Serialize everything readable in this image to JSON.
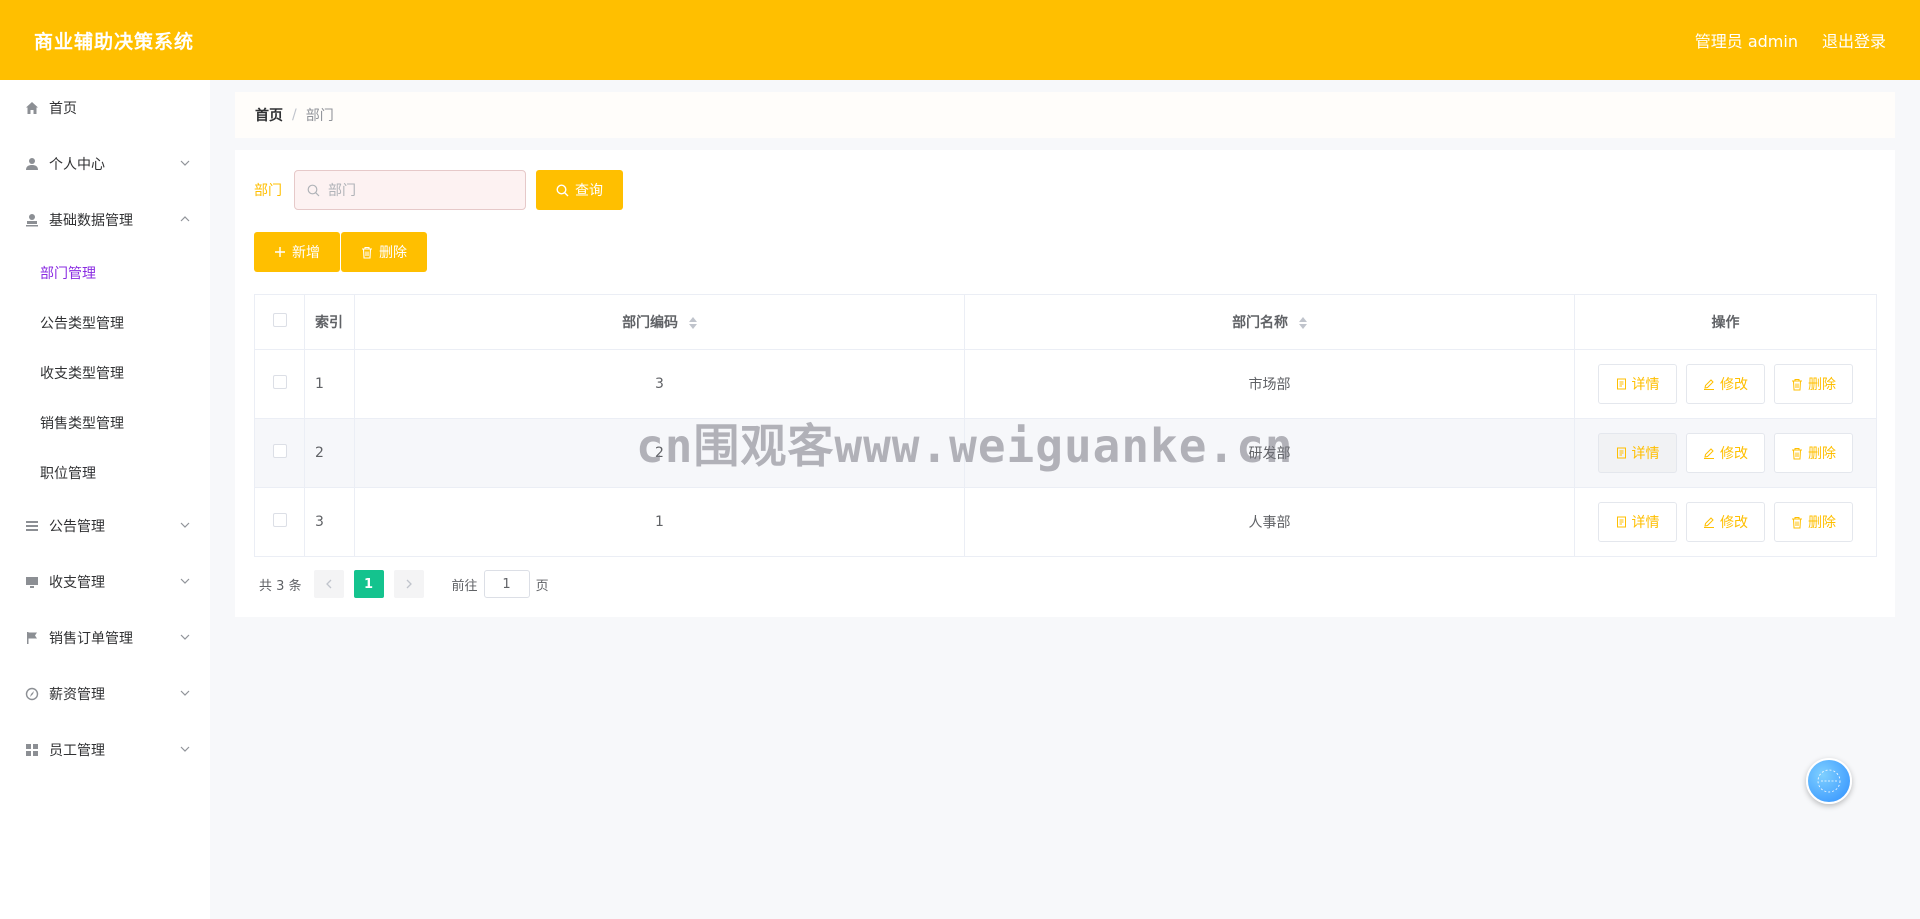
{
  "header": {
    "title": "商业辅助决策系统",
    "user_label": "管理员 admin",
    "logout_label": "退出登录"
  },
  "sidebar": {
    "items": [
      {
        "label": "首页",
        "icon": "home-icon"
      },
      {
        "label": "个人中心",
        "icon": "user-icon"
      },
      {
        "label": "基础数据管理",
        "icon": "stamp-icon",
        "expanded": true,
        "children": [
          {
            "label": "部门管理",
            "active": true
          },
          {
            "label": "公告类型管理"
          },
          {
            "label": "收支类型管理"
          },
          {
            "label": "销售类型管理"
          },
          {
            "label": "职位管理"
          }
        ]
      },
      {
        "label": "公告管理",
        "icon": "list-icon"
      },
      {
        "label": "收支管理",
        "icon": "monitor-icon"
      },
      {
        "label": "销售订单管理",
        "icon": "flag-icon"
      },
      {
        "label": "薪资管理",
        "icon": "compass-icon"
      },
      {
        "label": "员工管理",
        "icon": "grid-icon"
      }
    ]
  },
  "breadcrumb": {
    "home": "首页",
    "separator": "/",
    "current": "部门"
  },
  "search": {
    "label": "部门",
    "placeholder": "部门",
    "query_label": "查询"
  },
  "actions": {
    "add_label": "新增",
    "delete_label": "删除"
  },
  "table": {
    "headers": {
      "index": "索引",
      "code": "部门编码",
      "name": "部门名称",
      "ops": "操作"
    },
    "rows": [
      {
        "index": "1",
        "code": "3",
        "name": "市场部"
      },
      {
        "index": "2",
        "code": "2",
        "name": "研发部"
      },
      {
        "index": "3",
        "code": "1",
        "name": "人事部"
      }
    ],
    "op_labels": {
      "detail": "详情",
      "edit": "修改",
      "delete": "删除"
    }
  },
  "pagination": {
    "total": "共 3 条",
    "current_page": "1",
    "goto_label": "前往",
    "goto_value": "1",
    "page_unit": "页"
  },
  "watermark": "cn围观客www.weiguanke.cn",
  "colors": {
    "accent": "#ffbf00",
    "active_menu": "#8a2be2",
    "page_active": "#14c38e"
  }
}
